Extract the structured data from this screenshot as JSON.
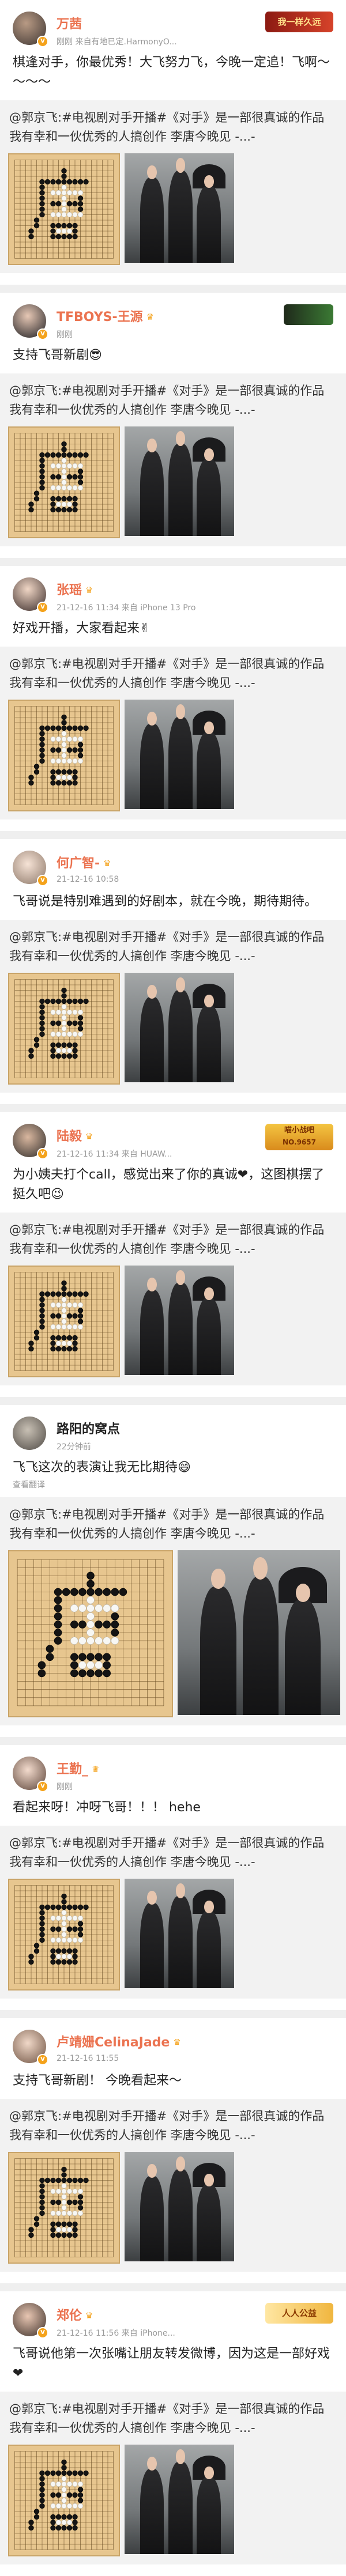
{
  "colors": {
    "link": "#eb7350",
    "meta": "#9a9a9a",
    "repost_bg": "#f2f2f2"
  },
  "posts": [
    {
      "name": "万茜",
      "meta": "刚刚  来自有地已定.HarmonyO...",
      "deco": "我一样久远",
      "text": "棋逢对手，你最优秀！大飞努力飞，今晚一定追！飞啊～～～～",
      "repost": "@郭京飞:#电视剧对手开播#《对手》是一部很真诚的作品 我有幸和一伙优秀的人搞创作 李唐今晚见 -...-"
    },
    {
      "name": "TFBOYS-王源",
      "meta": "刚刚",
      "deco": "",
      "text": "支持飞哥新剧😎",
      "repost": "@郭京飞:#电视剧对手开播#《对手》是一部很真诚的作品 我有幸和一伙优秀的人搞创作 李唐今晚见 -...-"
    },
    {
      "name": "张瑶",
      "meta": "21-12-16 11:34  来自 iPhone 13 Pro",
      "text": "好戏开播，大家看起来✌",
      "repost": "@郭京飞:#电视剧对手开播#《对手》是一部很真诚的作品 我有幸和一伙优秀的人搞创作 李唐今晚见 -...-"
    },
    {
      "name": "何广智-",
      "meta": "21-12-16 10:58",
      "text": "飞哥说是特别难遇到的好剧本，就在今晚，期待期待。",
      "repost": "@郭京飞:#电视剧对手开播#《对手》是一部很真诚的作品 我有幸和一伙优秀的人搞创作 李唐今晚见 -...-"
    },
    {
      "name": "陆毅",
      "meta": "21-12-16 11:34  来自 HUAW...",
      "deco_line1": "喵小战吧",
      "deco_line2": "NO.9657",
      "text": "为小姨夫打个call，感觉出来了你的真诚❤，这图棋摆了挺久吧😉",
      "repost": "@郭京飞:#电视剧对手开播#《对手》是一部很真诚的作品 我有幸和一伙优秀的人搞创作 李唐今晚见 -...-"
    },
    {
      "name": "路阳的窝点",
      "meta": "22分钟前",
      "text": "飞飞这次的表演让我无比期待😄",
      "sub": "查看翻译",
      "repost": "@郭京飞:#电视剧对手开播#《对手》是一部很真诚的作品 我有幸和一伙优秀的人搞创作 李唐今晚见 -...-"
    },
    {
      "name": "王勤_",
      "meta": "刚刚",
      "text": "看起来呀！冲呀飞哥！！！ hehe",
      "repost": "@郭京飞:#电视剧对手开播#《对手》是一部很真诚的作品 我有幸和一伙优秀的人搞创作 李唐今晚见 -...-"
    },
    {
      "name": "卢靖姗CelinaJade",
      "meta": "21-12-16 11:55",
      "text": "支持飞哥新剧！ 今晚看起来～",
      "repost": "@郭京飞:#电视剧对手开播#《对手》是一部很真诚的作品 我有幸和一伙优秀的人搞创作 李唐今晚见 -...-"
    },
    {
      "name": "郑伦",
      "meta": "21-12-16 11:56  来自 iPhone...",
      "deco": "人人公益",
      "text": "飞哥说他第一次张嘴让朋友转发微博，因为这是一部好戏❤",
      "repost": "@郭京飞:#电视剧对手开播#《对手》是一部很真诚的作品 我有幸和一伙优秀的人搞创作 李唐今晚见 -...-"
    }
  ]
}
